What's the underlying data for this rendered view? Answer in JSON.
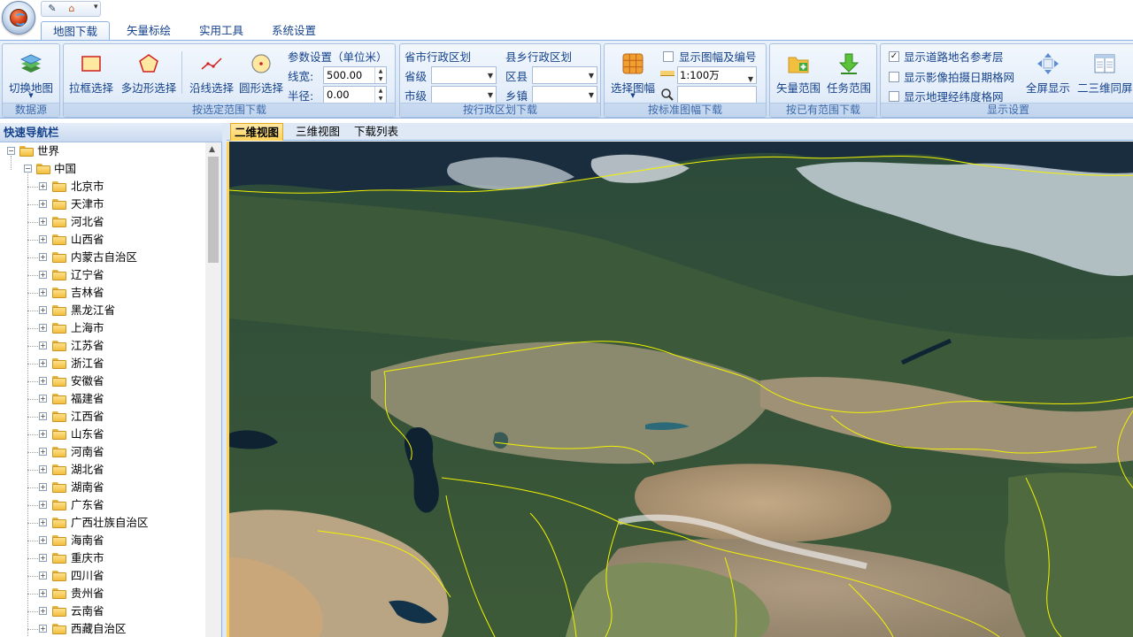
{
  "qat": {
    "btn1": "✎",
    "btn2": "⌂",
    "more": "▾"
  },
  "tabs": [
    "地图下载",
    "矢量标绘",
    "实用工具",
    "系统设置"
  ],
  "ribbon": {
    "datasource": {
      "label": "数据源",
      "switch_map": "切换地图"
    },
    "range": {
      "label": "按选定范围下载",
      "rect": "拉框选择",
      "polygon": "多边形选择",
      "line": "沿线选择",
      "circle": "圆形选择",
      "params_title": "参数设置（单位米）",
      "linewidth_label": "线宽:",
      "linewidth_value": "500.00",
      "radius_label": "半径:",
      "radius_value": "0.00"
    },
    "admin": {
      "label": "按行政区划下载",
      "prov_title": "省市行政区划",
      "prov_label": "省级",
      "city_label": "市级",
      "county_title": "县乡行政区划",
      "county_label": "区县",
      "town_label": "乡镇"
    },
    "sheet": {
      "label": "按标准图幅下载",
      "select": "选择图幅",
      "show_sheet": "显示图幅及编号",
      "scale": "1:100万"
    },
    "existing": {
      "label": "按已有范围下载",
      "vector": "矢量范围",
      "task": "任务范围"
    },
    "display": {
      "label": "显示设置",
      "road": "显示道路地名参考层",
      "date_grid": "显示影像拍摄日期格网",
      "latlon_grid": "显示地理经纬度格网",
      "fullscreen": "全屏显示",
      "same_2d3d": "二三维同屏",
      "checked_road": true
    }
  },
  "nav": {
    "title": "快速导航栏",
    "root": "世界",
    "country": "中国",
    "provinces": [
      "北京市",
      "天津市",
      "河北省",
      "山西省",
      "内蒙古自治区",
      "辽宁省",
      "吉林省",
      "黑龙江省",
      "上海市",
      "江苏省",
      "浙江省",
      "安徽省",
      "福建省",
      "江西省",
      "山东省",
      "河南省",
      "湖北省",
      "湖南省",
      "广东省",
      "广西壮族自治区",
      "海南省",
      "重庆市",
      "四川省",
      "贵州省",
      "云南省",
      "西藏自治区"
    ]
  },
  "map_tabs": [
    "二维视图",
    "三维视图",
    "下载列表"
  ],
  "colors": {
    "accent": "#ffd25a",
    "border_yellow": "#ffff00"
  }
}
